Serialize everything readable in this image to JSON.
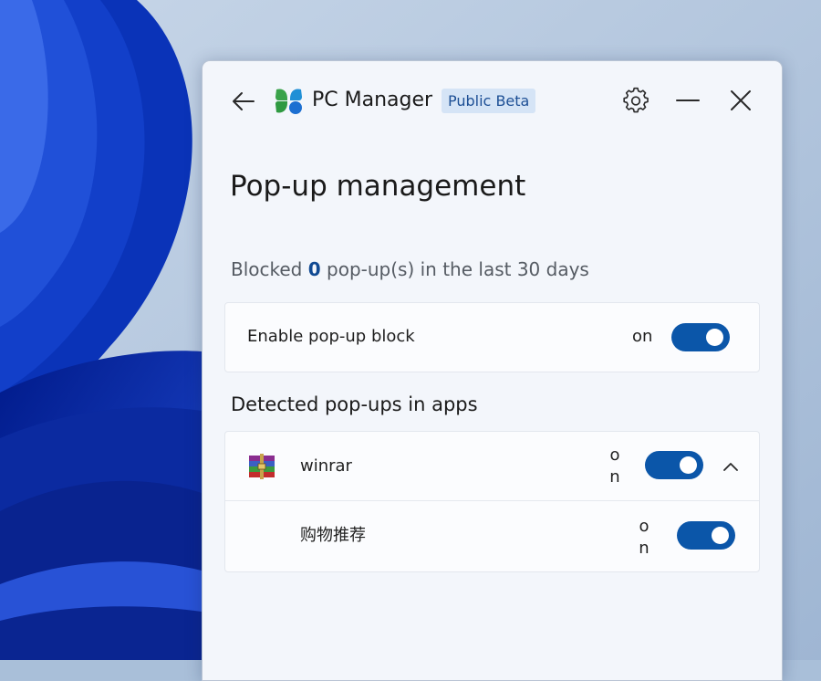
{
  "window": {
    "app_title": "PC Manager",
    "badge": "Public Beta"
  },
  "page": {
    "title": "Pop-up management",
    "blocked_prefix": "Blocked ",
    "blocked_count": "0",
    "blocked_suffix": " pop-up(s) in the last 30 days"
  },
  "enable_block": {
    "label": "Enable pop-up block",
    "state_label": "on",
    "enabled": true
  },
  "detected": {
    "section_title": "Detected pop-ups in apps",
    "apps": [
      {
        "name": "winrar",
        "state_label": "on",
        "enabled": true,
        "expanded": true,
        "icon": "winrar-archive-icon",
        "subitems": [
          {
            "label": "购物推荐",
            "state_label": "on",
            "enabled": true
          }
        ]
      }
    ]
  },
  "colors": {
    "accent": "#0b56a9",
    "badge_bg": "#d5e4f6",
    "badge_text": "#1d4f95",
    "window_bg": "#f3f6fb"
  }
}
